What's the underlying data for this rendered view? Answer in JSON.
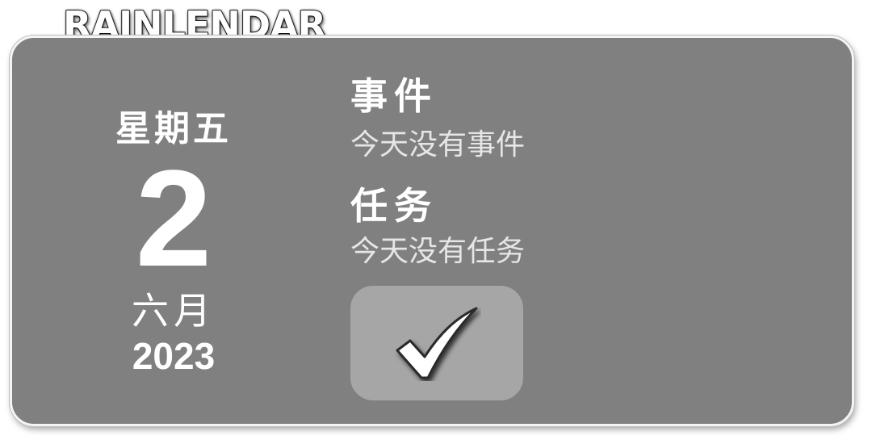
{
  "app": {
    "brand": "RAINLENDAR"
  },
  "date": {
    "weekday": "星期五",
    "day": "2",
    "month": "六月",
    "year": "2023"
  },
  "events": {
    "title": "事件",
    "empty_text": "今天没有事件"
  },
  "tasks": {
    "title": "任务",
    "empty_text": "今天没有任务"
  },
  "actions": {
    "done_icon": "checkmark-icon"
  },
  "colors": {
    "panel": "#808080",
    "button": "#a6a6a6",
    "text": "#ffffff"
  }
}
